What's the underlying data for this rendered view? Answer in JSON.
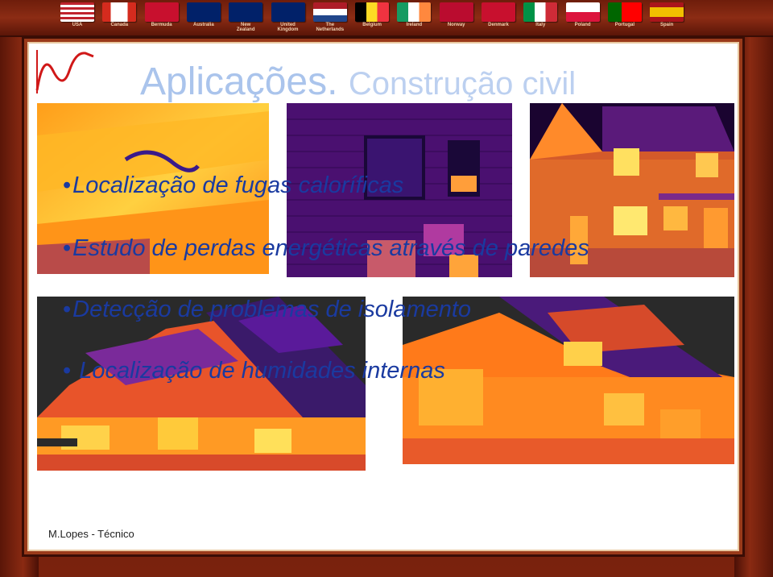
{
  "flags": [
    {
      "label": "USA"
    },
    {
      "label": "Canada"
    },
    {
      "label": "Bermuda"
    },
    {
      "label": "Australia"
    },
    {
      "label": "New\nZealand"
    },
    {
      "label": "United\nKingdom"
    },
    {
      "label": "The\nNetherlands"
    },
    {
      "label": "Belgium"
    },
    {
      "label": "Ireland"
    },
    {
      "label": "Norway"
    },
    {
      "label": "Denmark"
    },
    {
      "label": "Italy"
    },
    {
      "label": "Poland"
    },
    {
      "label": "Portugal"
    },
    {
      "label": "Spain"
    }
  ],
  "slide": {
    "title_main": "Aplicações.",
    "title_sub": "Construção civil",
    "bullets": [
      "Localização de fugas caloríficas",
      "Estudo de perdas energéticas através de paredes",
      "Detecção de problemas de isolamento",
      " Localização de humidades internas"
    ],
    "footer": "M.Lopes - Técnico"
  },
  "colors": {
    "frame": "#8a2a12",
    "title": "#aac4ec",
    "bullet_text": "#1a3aa0"
  }
}
